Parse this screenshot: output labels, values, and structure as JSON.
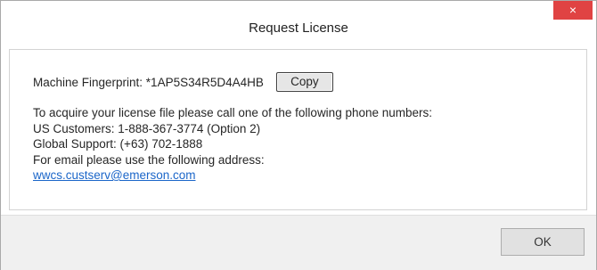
{
  "window": {
    "title": "Request License",
    "close_label": "×"
  },
  "fingerprint": {
    "label": "Machine Fingerprint: *1AP5S34R5D4A4HB",
    "copy_label": "Copy"
  },
  "info": {
    "line1": "To acquire your license file please call one of the following phone numbers:",
    "line2": "US Customers: 1-888-367-3774 (Option 2)",
    "line3": "Global Support: (+63) 702-1888",
    "line4": "For email please use the following address:",
    "email": "wwcs.custserv@emerson.com"
  },
  "footer": {
    "ok_label": "OK"
  },
  "colors": {
    "close_button": "#e04343",
    "link": "#1b66c9",
    "footer_bg": "#f0f0f0"
  }
}
